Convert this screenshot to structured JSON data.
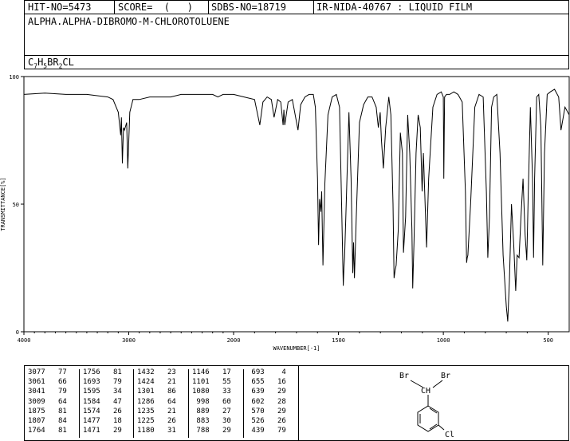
{
  "header": {
    "hit_no": "HIT-NO=5473",
    "score": "SCORE=  (   )",
    "sdbs_no": "SDBS-NO=18719",
    "ir": "IR-NIDA-40767 : LIQUID FILM"
  },
  "compound": {
    "name": "ALPHA.ALPHA-DIBROMO-M-CHLOROTOLUENE",
    "formula_parts": [
      "C",
      "7",
      "H",
      "5",
      "BR",
      "2",
      "CL"
    ]
  },
  "structure": {
    "br_left": "Br",
    "br_right": "Br",
    "ch": "CH",
    "cl": "Cl"
  },
  "peak_table": {
    "columns": [
      [
        [
          "3077",
          "77"
        ],
        [
          "3061",
          "66"
        ],
        [
          "3041",
          "79"
        ],
        [
          "3009",
          "64"
        ],
        [
          "1875",
          "81"
        ],
        [
          "1807",
          "84"
        ],
        [
          "1764",
          "81"
        ]
      ],
      [
        [
          "1756",
          "81"
        ],
        [
          "1693",
          "79"
        ],
        [
          "1595",
          "34"
        ],
        [
          "1584",
          "47"
        ],
        [
          "1574",
          "26"
        ],
        [
          "1477",
          "18"
        ],
        [
          "1471",
          "29"
        ]
      ],
      [
        [
          "1432",
          "23"
        ],
        [
          "1424",
          "21"
        ],
        [
          "1301",
          "86"
        ],
        [
          "1286",
          "64"
        ],
        [
          "1235",
          "21"
        ],
        [
          "1225",
          "26"
        ],
        [
          "1180",
          "31"
        ]
      ],
      [
        [
          "1146",
          "17"
        ],
        [
          "1101",
          "55"
        ],
        [
          "1080",
          "33"
        ],
        [
          "998",
          "60"
        ],
        [
          "889",
          "27"
        ],
        [
          "883",
          "30"
        ],
        [
          "788",
          "29"
        ]
      ],
      [
        [
          "693",
          "4"
        ],
        [
          "655",
          "16"
        ],
        [
          "639",
          "29"
        ],
        [
          "602",
          "28"
        ],
        [
          "570",
          "29"
        ],
        [
          "526",
          "26"
        ],
        [
          "439",
          "79"
        ]
      ]
    ]
  },
  "chart_data": {
    "type": "line",
    "xlabel": "WAVENUMBER[-1]",
    "ylabel": "TRANSMITTANCE[%]",
    "xlim": [
      4000,
      400
    ],
    "ylim": [
      0,
      100
    ],
    "x_ticks": [
      4000,
      3000,
      2000,
      1500,
      1000,
      500
    ],
    "y_ticks": [
      0,
      50,
      100
    ],
    "x_tick_labels": [
      "4000",
      "3000",
      "2000",
      "1500",
      "1000",
      "500"
    ],
    "y_tick_labels": [
      "0",
      "50",
      "100"
    ],
    "line_color": "#000000",
    "series": [
      {
        "x": [
          4000,
          3800,
          3600,
          3400,
          3200,
          3150,
          3100,
          3077,
          3070,
          3061,
          3050,
          3041,
          3020,
          3009,
          2990,
          2960,
          2900,
          2800,
          2700,
          2600,
          2500,
          2400,
          2300,
          2200,
          2150,
          2100,
          2000,
          1950,
          1900,
          1875,
          1860,
          1840,
          1820,
          1807,
          1790,
          1775,
          1764,
          1760,
          1756,
          1740,
          1720,
          1693,
          1680,
          1660,
          1640,
          1620,
          1610,
          1600,
          1595,
          1590,
          1584,
          1580,
          1574,
          1565,
          1550,
          1530,
          1510,
          1495,
          1485,
          1477,
          1474,
          1471,
          1465,
          1450,
          1440,
          1432,
          1428,
          1424,
          1415,
          1400,
          1380,
          1360,
          1340,
          1320,
          1310,
          1301,
          1295,
          1286,
          1275,
          1260,
          1250,
          1240,
          1235,
          1230,
          1225,
          1215,
          1205,
          1195,
          1190,
          1180,
          1170,
          1160,
          1150,
          1146,
          1140,
          1130,
          1120,
          1110,
          1101,
          1095,
          1080,
          1070,
          1050,
          1030,
          1010,
          1000,
          998,
          994,
          985,
          970,
          950,
          930,
          910,
          895,
          889,
          886,
          883,
          870,
          850,
          830,
          810,
          795,
          788,
          780,
          770,
          760,
          745,
          730,
          715,
          700,
          693,
          685,
          675,
          665,
          655,
          648,
          639,
          630,
          620,
          610,
          602,
          595,
          585,
          575,
          570,
          565,
          555,
          545,
          535,
          526,
          518,
          505,
          490,
          470,
          450,
          439,
          420,
          400
        ],
        "y": [
          93,
          93.5,
          93,
          93,
          92,
          91,
          86,
          77,
          84,
          66,
          80,
          79,
          82,
          64,
          86,
          91,
          91,
          92,
          92,
          92,
          93,
          93,
          93,
          93,
          92,
          93,
          93,
          92,
          91,
          81,
          90,
          92,
          91,
          84,
          91,
          90,
          81,
          87,
          81,
          90,
          91,
          79,
          89,
          92,
          93,
          93,
          88,
          60,
          34,
          52,
          47,
          55,
          26,
          58,
          85,
          92,
          93,
          88,
          50,
          18,
          25,
          29,
          45,
          86,
          60,
          23,
          35,
          21,
          45,
          82,
          89,
          92,
          92,
          88,
          80,
          86,
          75,
          64,
          80,
          92,
          85,
          50,
          21,
          24,
          26,
          40,
          78,
          70,
          31,
          45,
          85,
          70,
          40,
          17,
          35,
          70,
          85,
          80,
          55,
          70,
          33,
          60,
          88,
          93,
          94,
          92,
          60,
          92,
          93,
          93,
          94,
          93,
          90,
          55,
          27,
          29,
          30,
          50,
          88,
          93,
          92,
          55,
          29,
          45,
          88,
          92,
          93,
          70,
          30,
          10,
          4,
          20,
          50,
          35,
          16,
          30,
          29,
          45,
          60,
          38,
          28,
          55,
          88,
          60,
          29,
          60,
          92,
          93,
          80,
          26,
          70,
          93,
          94,
          95,
          92,
          79,
          88,
          85
        ]
      }
    ]
  }
}
